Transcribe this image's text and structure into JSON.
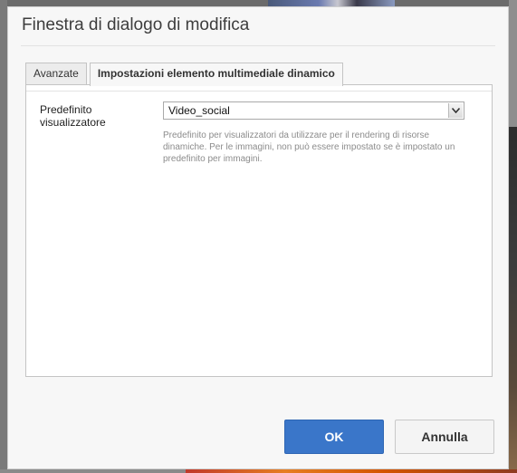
{
  "dialog": {
    "title": "Finestra di dialogo di modifica"
  },
  "tabs": [
    {
      "label": "Avanzate",
      "active": false
    },
    {
      "label": "Impostazioni elemento multimediale dinamico",
      "active": true
    }
  ],
  "field": {
    "label_line1": "Predefinito",
    "label_line2": "visualizzatore",
    "selected_value": "Video_social",
    "dropdown_icon": "chevron-down-icon",
    "help_text": "Predefinito per visualizzatori da utilizzare per il rendering di risorse dinamiche. Per le immagini, non può essere impostato se è impostato un predefinito per immagini."
  },
  "buttons": {
    "ok_label": "OK",
    "cancel_label": "Annulla"
  },
  "colors": {
    "primary_button": "#3a76c9",
    "dialog_background": "#f7f7f7"
  }
}
